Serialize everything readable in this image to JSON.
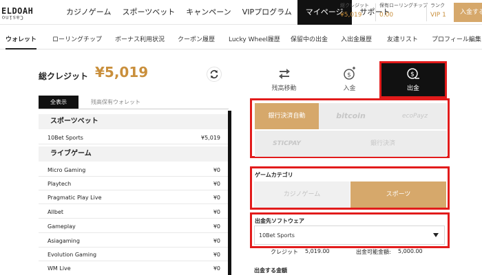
{
  "logo": {
    "main": "ELDOAH",
    "flipped": "Casino",
    "mark": "EL"
  },
  "nav": [
    "カジノゲーム",
    "スポーツベット",
    "キャンペーン",
    "VIPプログラム",
    "マイページ",
    "サポート"
  ],
  "nav_active_index": 4,
  "stats": {
    "credit_label": "総クレジット",
    "credit_value": "¥5,019",
    "chip_label": "保有ローリングチップ",
    "chip_value": "0.00",
    "rank_label": "ランク",
    "rank_value": "VIP 1"
  },
  "deposit_button": "入金する",
  "tabs": [
    "ウォレット",
    "ローリングチップ",
    "ボーナス利用状況",
    "クーポン履歴",
    "Lucky Wheel履歴",
    "保留中の出金",
    "入出金履歴",
    "友達リスト",
    "プロフィール編集"
  ],
  "tab_active_index": 0,
  "wallet": {
    "credit_label": "総クレジット",
    "credit_value": "¥5,019",
    "tab_all": "全表示",
    "tab_held": "残高保有ウォレット",
    "sports_section": "スポーツベット",
    "sports_rows": [
      {
        "name": "10Bet Sports",
        "amount": "¥5,019"
      }
    ],
    "live_section": "ライブゲーム",
    "live_rows": [
      {
        "name": "Micro Gaming",
        "amount": "¥0"
      },
      {
        "name": "Playtech",
        "amount": "¥0"
      },
      {
        "name": "Pragmatic Play Live",
        "amount": "¥0"
      },
      {
        "name": "Allbet",
        "amount": "¥0"
      },
      {
        "name": "Gameplay",
        "amount": "¥0"
      },
      {
        "name": "Asiagaming",
        "amount": "¥0"
      },
      {
        "name": "Evolution Gaming",
        "amount": "¥0"
      },
      {
        "name": "WM Live",
        "amount": "¥0"
      }
    ]
  },
  "actions": [
    {
      "label": "残高移動",
      "icon": "transfer-icon"
    },
    {
      "label": "入金",
      "icon": "deposit-icon"
    },
    {
      "label": "出金",
      "icon": "withdraw-icon"
    }
  ],
  "payment_methods": [
    "銀行決済自動",
    "bitcoin",
    "ecoPayz",
    "STICPAY",
    "銀行決済"
  ],
  "game_category": {
    "title": "ゲームカテゴリ",
    "options": [
      "カジノゲーム",
      "スポーツ"
    ],
    "selected_index": 1
  },
  "software": {
    "title": "出金先ソフトウェア",
    "selected": "10Bet Sports"
  },
  "balances": {
    "credit_label": "クレジット",
    "credit_value": "5,019.00",
    "available_label": "出金可能金額:",
    "available_value": "5,000.00"
  },
  "withdraw_amount_label": "出金する金額",
  "colors": {
    "accent": "#d6a86b",
    "gold_text": "#c98f3c",
    "highlight": "#e21b1b",
    "dark": "#111111"
  }
}
